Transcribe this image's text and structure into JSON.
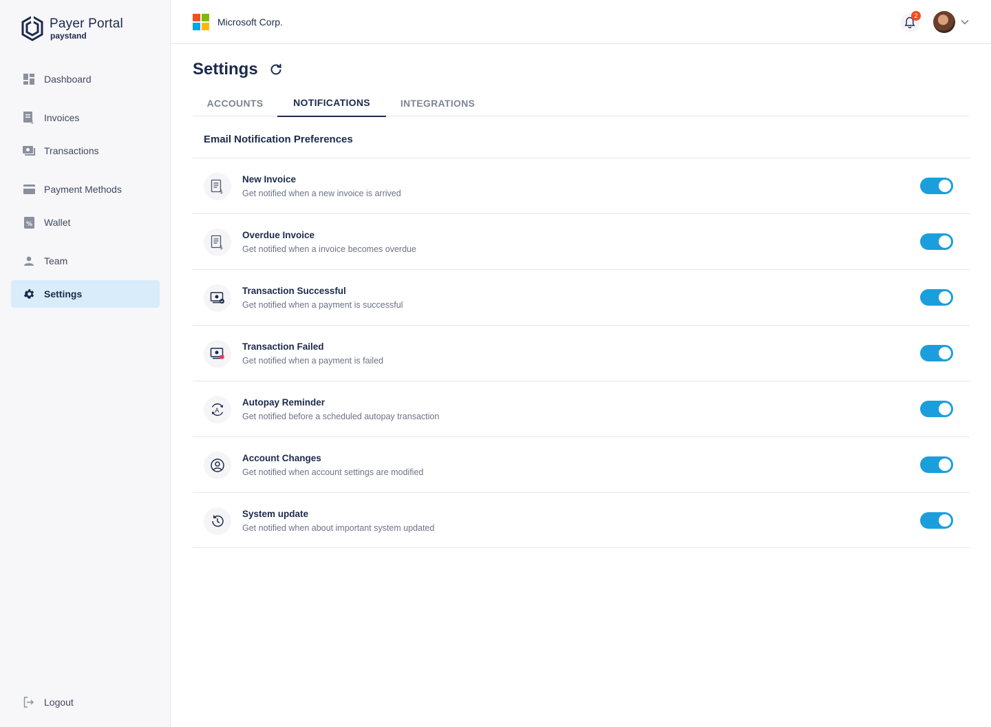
{
  "brand": {
    "title": "Payer Portal",
    "subtitle": "paystand"
  },
  "sidebar": {
    "items": [
      {
        "label": "Dashboard",
        "icon": "dashboard-icon"
      },
      {
        "label": "Invoices",
        "icon": "invoice-icon"
      },
      {
        "label": "Transactions",
        "icon": "transactions-icon"
      },
      {
        "label": "Payment Methods",
        "icon": "credit-card-icon"
      },
      {
        "label": "Wallet",
        "icon": "wallet-icon"
      },
      {
        "label": "Team",
        "icon": "person-icon"
      },
      {
        "label": "Settings",
        "icon": "gear-icon",
        "active": true
      }
    ],
    "logout": {
      "label": "Logout",
      "icon": "logout-icon"
    }
  },
  "header": {
    "company": "Microsoft Corp.",
    "notification_count": "2",
    "colors": {
      "ms_red": "#f25022",
      "ms_green": "#7fba00",
      "ms_blue": "#00a4ef",
      "ms_yellow": "#ffb900"
    }
  },
  "page": {
    "title": "Settings",
    "tabs": [
      {
        "label": "ACCOUNTS"
      },
      {
        "label": "NOTIFICATIONS",
        "active": true
      },
      {
        "label": "INTEGRATIONS"
      }
    ],
    "section_title": "Email Notification Preferences",
    "preferences": [
      {
        "title": "New Invoice",
        "description": "Get notified when a new invoice is arrived",
        "icon": "invoice-icon",
        "enabled": true
      },
      {
        "title": "Overdue Invoice",
        "description": "Get notified when a invoice becomes overdue",
        "icon": "invoice-icon",
        "enabled": true
      },
      {
        "title": "Transaction Successful",
        "description": "Get notified when a payment is successful",
        "icon": "payment-success-icon",
        "enabled": true
      },
      {
        "title": "Transaction Failed",
        "description": "Get notified when a payment is failed",
        "icon": "payment-failed-icon",
        "enabled": true
      },
      {
        "title": "Autopay Reminder",
        "description": "Get notified before a scheduled autopay transaction",
        "icon": "autopay-icon",
        "enabled": true
      },
      {
        "title": "Account Changes",
        "description": "Get notified when account settings are modified",
        "icon": "account-circle-icon",
        "enabled": true
      },
      {
        "title": "System update",
        "description": "Get notified when about important system updated",
        "icon": "history-icon",
        "enabled": true
      }
    ]
  },
  "colors": {
    "accent": "#1b9fdc",
    "active_nav_bg": "#d8ecfa",
    "text_dark": "#1b2a4a",
    "badge": "#f04e23"
  }
}
